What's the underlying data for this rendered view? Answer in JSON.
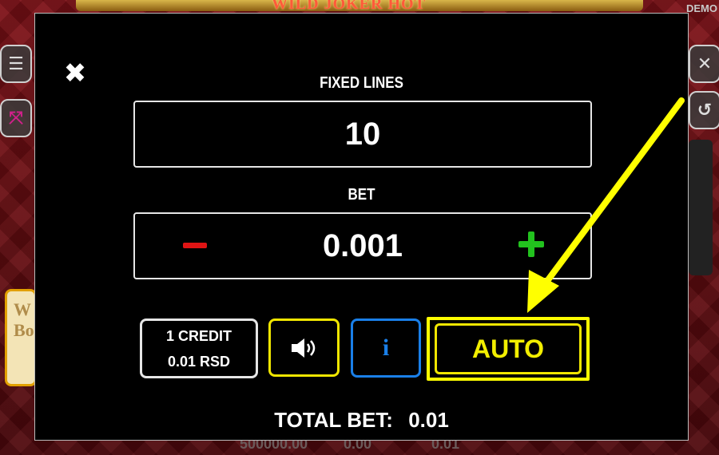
{
  "background": {
    "logo_text": "WILD JOKER HOT",
    "demo_label": "DEMO",
    "bonus_text": "W\nBo",
    "bottom_values": [
      "500000.00",
      "0.00",
      "0.01"
    ]
  },
  "modal": {
    "close_icon": "close-icon",
    "fixed_lines_label": "FIXED LINES",
    "fixed_lines_value": "10",
    "bet_label": "BET",
    "bet_value": "0.001",
    "decrease_icon": "minus-icon",
    "increase_icon": "plus-icon",
    "credit_line1": "1 CREDIT",
    "credit_line2": "0.01 RSD",
    "sound_icon": "speaker-icon",
    "info_icon": "info-icon",
    "auto_label": "AUTO",
    "total_bet_label": "TOTAL BET:",
    "total_bet_value": "0.01"
  },
  "side": {
    "menu_icon": "menu-icon",
    "fullscreen_icon": "fullscreen-icon",
    "close_icon": "close-icon",
    "history_icon": "history-icon"
  },
  "colors": {
    "accent_yellow": "#ffff00",
    "minus_red": "#e01414",
    "plus_green": "#22c21e",
    "info_blue": "#1a7fe8"
  }
}
